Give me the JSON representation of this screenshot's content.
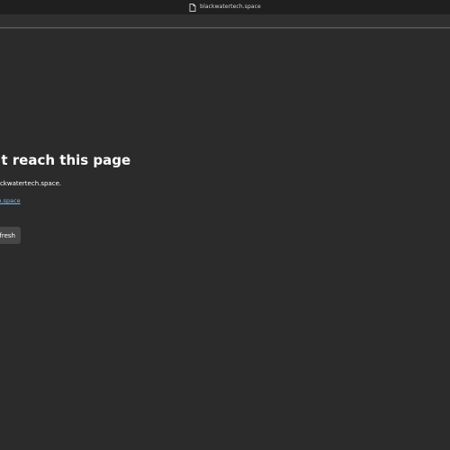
{
  "window": {
    "title": "blackwatertech.space"
  },
  "icons": {
    "title_icon": "page-icon"
  },
  "error": {
    "heading": "Hmm… can't reach this page",
    "description": "It looks like the webpage at https://blackwatertech.space/ might be having issues, or it may have moved permanently to a new web address. Could not find blackwatertech.space's server IP in blackwatertech.space.",
    "visible_heading": "an't reach this page",
    "visible_description": "p in blackwatertech.space.",
    "link_text": "atertech.space",
    "refresh_label": "fresh"
  },
  "colors": {
    "background": "#2b2b2b",
    "title_bar": "#1f1f1f",
    "link": "#7db8f0",
    "button": "#474747"
  }
}
